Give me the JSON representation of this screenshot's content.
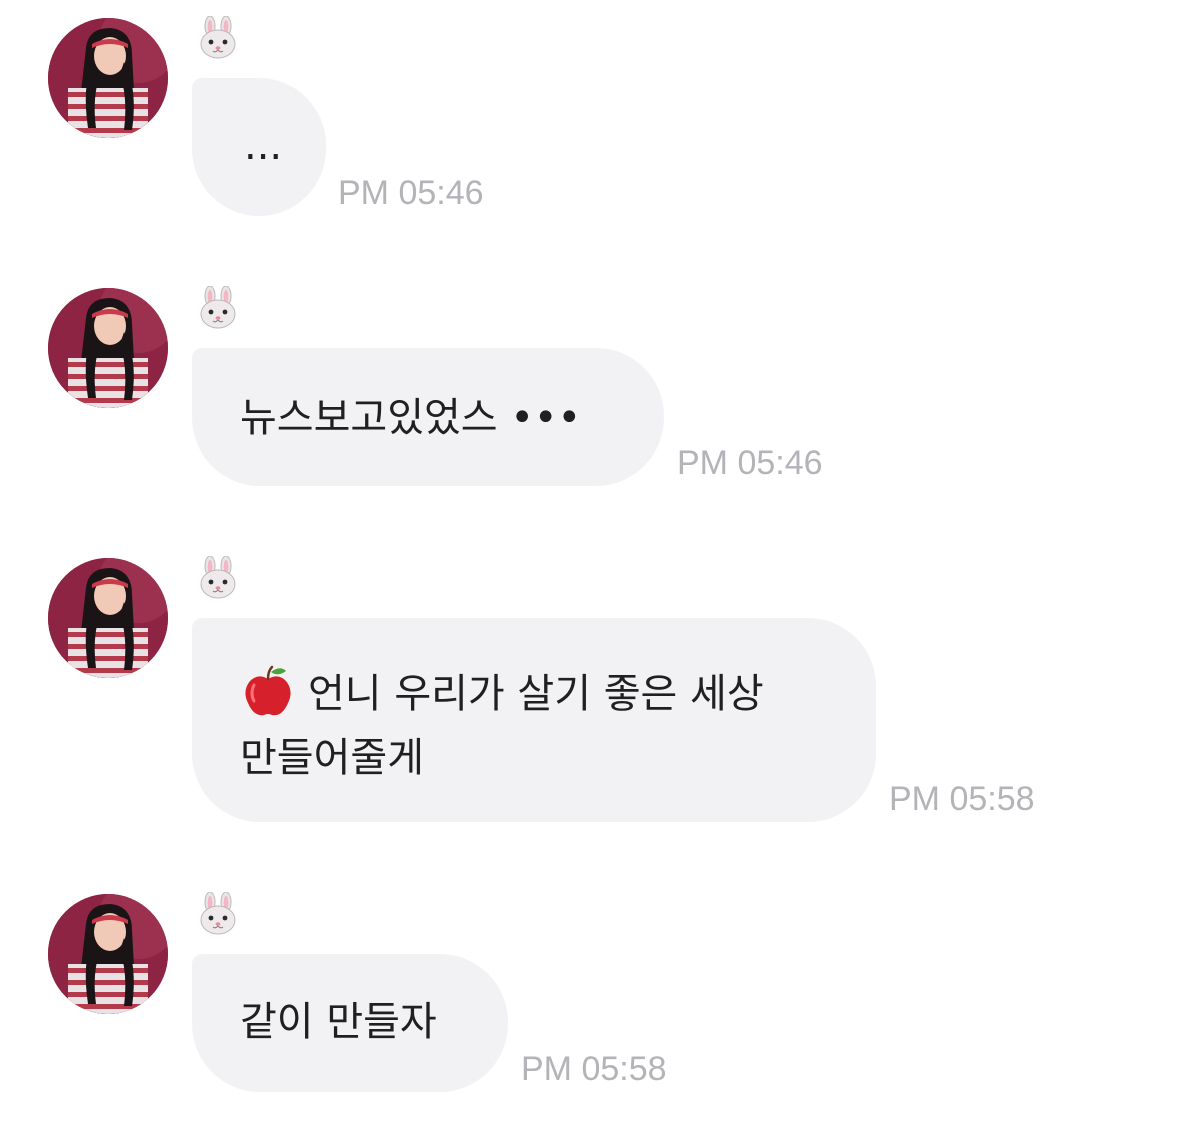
{
  "chat": {
    "messages": [
      {
        "sender_emoji": "rabbit-face",
        "text": "...",
        "time": "PM 05:46"
      },
      {
        "sender_emoji": "rabbit-face",
        "text": "뉴스보고있었스 •••",
        "time": "PM 05:46"
      },
      {
        "sender_emoji": "rabbit-face",
        "leading_emoji": "red-apple",
        "text_line1": "언니 우리가 살기 좋은 세상",
        "text_line2": "만들어줄게",
        "time": "PM 05:58"
      },
      {
        "sender_emoji": "rabbit-face",
        "text": "같이 만들자",
        "time": "PM 05:58"
      }
    ]
  },
  "colors": {
    "bubble_bg": "#f2f2f4",
    "timestamp": "#b3b3b8",
    "avatar_bg": "#8e2444",
    "text": "#202020"
  }
}
